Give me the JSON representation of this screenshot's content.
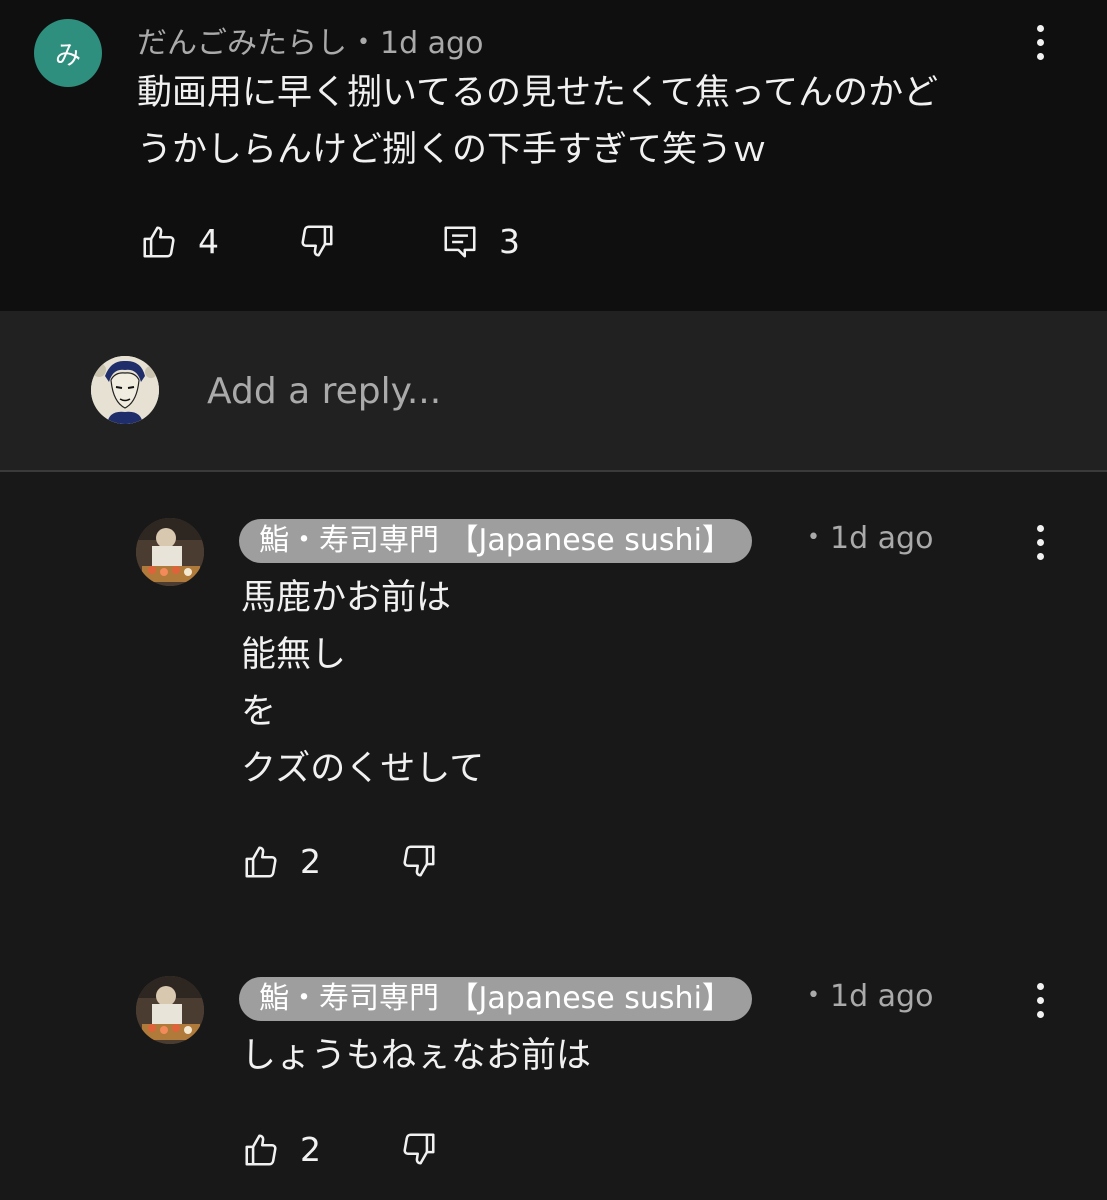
{
  "top_comment": {
    "avatar_letter": "み",
    "author": "だんごみたらし",
    "separator": "•",
    "time": "1d ago",
    "text": "動画用に早く捌いてるの見せたくて焦ってんのかど\nうかしらんけど捌くの下手すぎて笑うｗ",
    "likes": "4",
    "replies": "3",
    "icons": [
      "thumbs-up-icon",
      "thumbs-down-icon",
      "reply-comment-icon",
      "more-vert-icon"
    ],
    "avatar_color": "#2f8f7e"
  },
  "reply_box": {
    "placeholder": "Add a reply..."
  },
  "replies": [
    {
      "author": "鮨・寿司専門 【Japanese sushi】",
      "separator": "•",
      "time": "1d ago",
      "text": "馬鹿かお前は\n能無し\nを\nクズのくせして",
      "likes": "2"
    },
    {
      "author": "鮨・寿司専門 【Japanese sushi】",
      "separator": "•",
      "time": "1d ago",
      "text": "しょうもねぇなお前は",
      "likes": "2"
    }
  ],
  "colors": {
    "background": "#181818",
    "top_background": "#0f0f0f",
    "reply_box_background": "#212121",
    "author_pill": "#9e9e9e",
    "text": "#f1f1f1",
    "secondary_text": "#aaaaaa"
  }
}
